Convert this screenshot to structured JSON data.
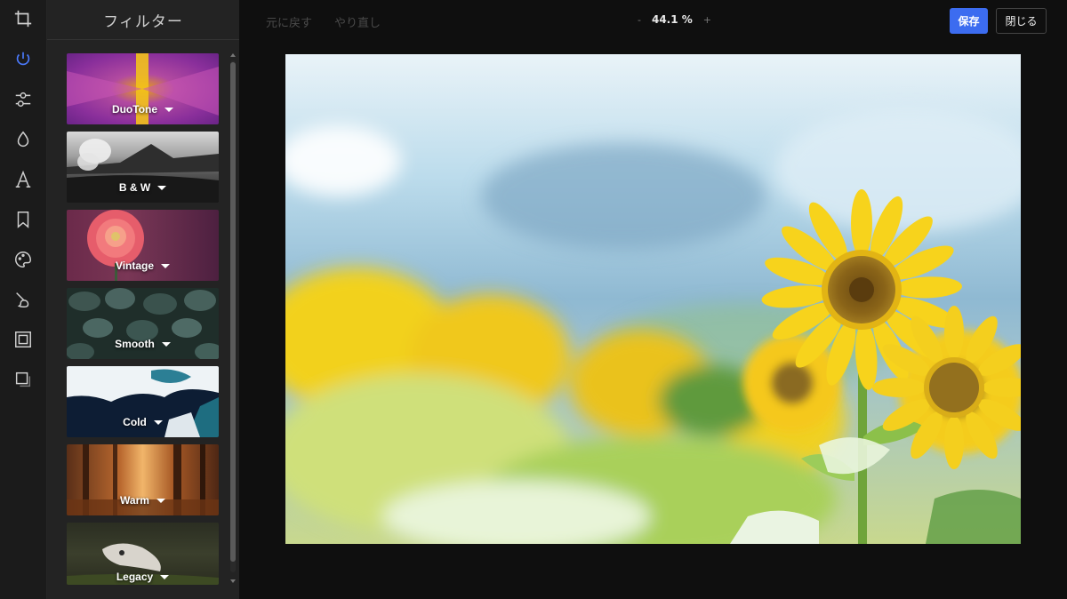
{
  "rail": {
    "icons": [
      "crop-icon",
      "filter-icon",
      "adjust-icon",
      "drop-icon",
      "text-icon",
      "sticker-icon",
      "palette-icon",
      "brush-icon",
      "frame-icon",
      "shape-icon"
    ]
  },
  "panel": {
    "title": "フィルター",
    "filters": [
      {
        "label": "DuoTone"
      },
      {
        "label": "B & W"
      },
      {
        "label": "Vintage"
      },
      {
        "label": "Smooth"
      },
      {
        "label": "Cold"
      },
      {
        "label": "Warm"
      },
      {
        "label": "Legacy"
      }
    ]
  },
  "toolbar": {
    "undo_label": "元に戻す",
    "redo_label": "やり直し",
    "zoom_out": "-",
    "zoom_value": "44.1 %",
    "zoom_in": "+",
    "save_label": "保存",
    "close_label": "閉じる"
  },
  "colors": {
    "accent": "#3c6cf0",
    "active_tool": "#4b7bff"
  }
}
